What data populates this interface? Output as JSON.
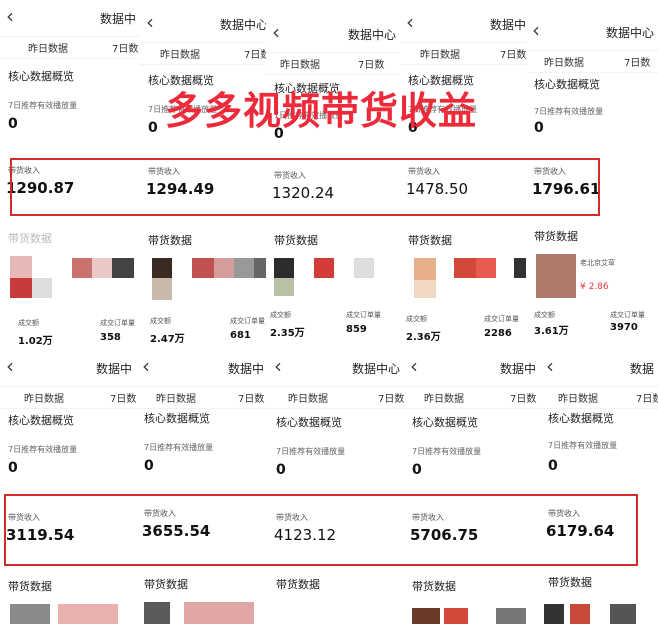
{
  "headline": "多多视频带货收益",
  "panels_top": [
    {
      "title": "数据中",
      "tab1": "昨日数据",
      "tab2": "7日数",
      "core": "核心数据概览",
      "rec_label": "7日推荐有效播放量",
      "rec_value": "0",
      "income_label": "带货收入",
      "income": "1290.87",
      "goods": "带货数据",
      "m1_label": "成交额",
      "m1": "1.02万",
      "m2_label": "成交订单量",
      "m2": "358"
    },
    {
      "title": "数据中心",
      "tab1": "昨日数据",
      "tab2": "7日数",
      "core": "核心数据概览",
      "rec_label": "7日推荐有效播放量",
      "rec_value": "0",
      "income_label": "带货收入",
      "income": "1294.49",
      "goods": "带货数据",
      "m1_label": "成交额",
      "m1": "2.47万",
      "m2_label": "成交订单量",
      "m2": "681"
    },
    {
      "title": "数据中心",
      "tab1": "昨日数据",
      "tab2": "7日数",
      "core": "核心数据概览",
      "rec_label": "7日推荐有效播放量",
      "rec_value": "0",
      "income_label": "带货收入",
      "income": "1320.24",
      "goods": "带货数据",
      "m1_label": "成交额",
      "m1": "2.35万",
      "m2_label": "成交订单量",
      "m2": "859"
    },
    {
      "title": "数据中",
      "tab1": "昨日数据",
      "tab2": "7日数",
      "core": "核心数据概览",
      "rec_label": "7日推荐有效播放量",
      "rec_value": "0",
      "income_label": "带货收入",
      "income": "1478.50",
      "goods": "带货数据",
      "m1_label": "成交额",
      "m1": "2.36万",
      "m2_label": "成交订单量",
      "m2": "2286"
    },
    {
      "title": "数据中心",
      "tab1": "昨日数据",
      "tab2": "7日数",
      "core": "核心数据概览",
      "rec_label": "7日推荐有效播放量",
      "rec_value": "0",
      "income_label": "带货收入",
      "income": "1796.61",
      "goods": "带货数据",
      "m1_label": "成交额",
      "m1": "3.61万",
      "m2_label": "成交订单量",
      "m2": "3970",
      "product": "老北京艾草",
      "price": "¥ 2.86"
    }
  ],
  "panels_bottom": [
    {
      "title": "数据中",
      "tab1": "昨日数据",
      "tab2": "7日数",
      "core": "核心数据概览",
      "rec_label": "7日推荐有效播放量",
      "rec_value": "0",
      "income_label": "带货收入",
      "income": "3119.54",
      "goods": "带货数据"
    },
    {
      "title": "数据中",
      "tab1": "昨日数据",
      "tab2": "7日数",
      "core": "核心数据概览",
      "rec_label": "7日推荐有效播放量",
      "rec_value": "0",
      "income_label": "带货收入",
      "income": "3655.54",
      "goods": "带货数据"
    },
    {
      "title": "数据中心",
      "tab1": "昨日数据",
      "tab2": "7日数",
      "core": "核心数据概览",
      "rec_label": "7日推荐有效播放量",
      "rec_value": "0",
      "income_label": "带货收入",
      "income": "4123.12",
      "goods": "带货数据"
    },
    {
      "title": "数据中",
      "tab1": "昨日数据",
      "tab2": "7日数",
      "core": "核心数据概览",
      "rec_label": "7日推荐有效播放量",
      "rec_value": "0",
      "income_label": "带货收入",
      "income": "5706.75",
      "goods": "带货数据"
    },
    {
      "title": "数据",
      "tab1": "昨日数据",
      "tab2": "7日数",
      "core": "核心数据概览",
      "rec_label": "7日推荐有效播放量",
      "rec_value": "0",
      "income_label": "带货收入",
      "income": "6179.64",
      "goods": "带货数据"
    }
  ],
  "colors": {
    "accent": "#d92a2a",
    "headline": "#ec2a3a"
  }
}
